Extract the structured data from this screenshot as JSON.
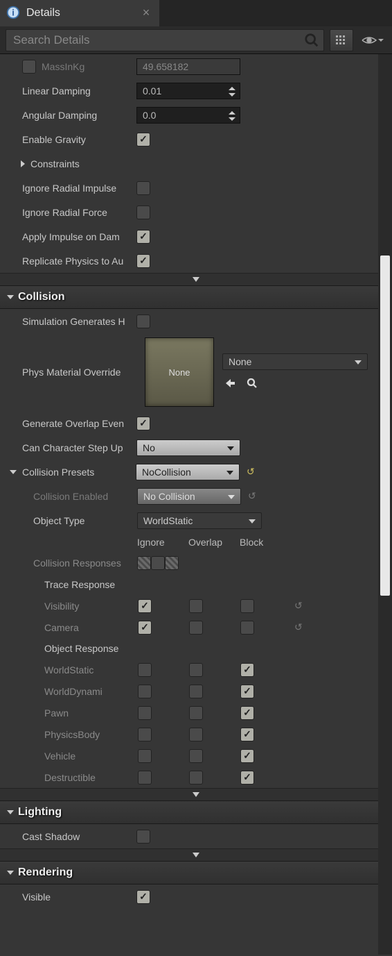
{
  "header": {
    "title": "Details"
  },
  "search": {
    "placeholder": "Search Details"
  },
  "physics": {
    "massLabel": "MassInKg",
    "massValue": "49.658182",
    "linearDampingLabel": "Linear Damping",
    "linearDampingValue": "0.01",
    "angularDampingLabel": "Angular Damping",
    "angularDampingValue": "0.0",
    "enableGravityLabel": "Enable Gravity",
    "constraintsLabel": "Constraints",
    "ignoreRadialImpulseLabel": "Ignore Radial Impulse",
    "ignoreRadialForceLabel": "Ignore Radial Force",
    "applyImpulseLabel": "Apply Impulse on Dam",
    "replicatePhysicsLabel": "Replicate Physics to Au"
  },
  "collision": {
    "categoryTitle": "Collision",
    "simGenHitsLabel": "Simulation Generates H",
    "physMatOverrideLabel": "Phys Material Override",
    "physMatThumb": "None",
    "physMatCombo": "None",
    "genOverlapLabel": "Generate Overlap Even",
    "canCharStepUpLabel": "Can Character Step Up",
    "canCharStepUpValue": "No",
    "presetsLabel": "Collision Presets",
    "presetsValue": "NoCollision",
    "collisionEnabledLabel": "Collision Enabled",
    "collisionEnabledValue": "No Collision",
    "objectTypeLabel": "Object Type",
    "objectTypeValue": "WorldStatic",
    "responsesLabel": "Collision Responses",
    "hdrIgnore": "Ignore",
    "hdrOverlap": "Overlap",
    "hdrBlock": "Block",
    "traceGroup": "Trace Response",
    "trace": {
      "visibility": "Visibility",
      "camera": "Camera"
    },
    "objectGroup": "Object Response",
    "objects": {
      "worldStatic": "WorldStatic",
      "worldDynamic": "WorldDynami",
      "pawn": "Pawn",
      "physicsBody": "PhysicsBody",
      "vehicle": "Vehicle",
      "destructible": "Destructible"
    }
  },
  "lighting": {
    "categoryTitle": "Lighting",
    "castShadowLabel": "Cast Shadow"
  },
  "rendering": {
    "categoryTitle": "Rendering",
    "visibleLabel": "Visible"
  },
  "chart_data": null
}
